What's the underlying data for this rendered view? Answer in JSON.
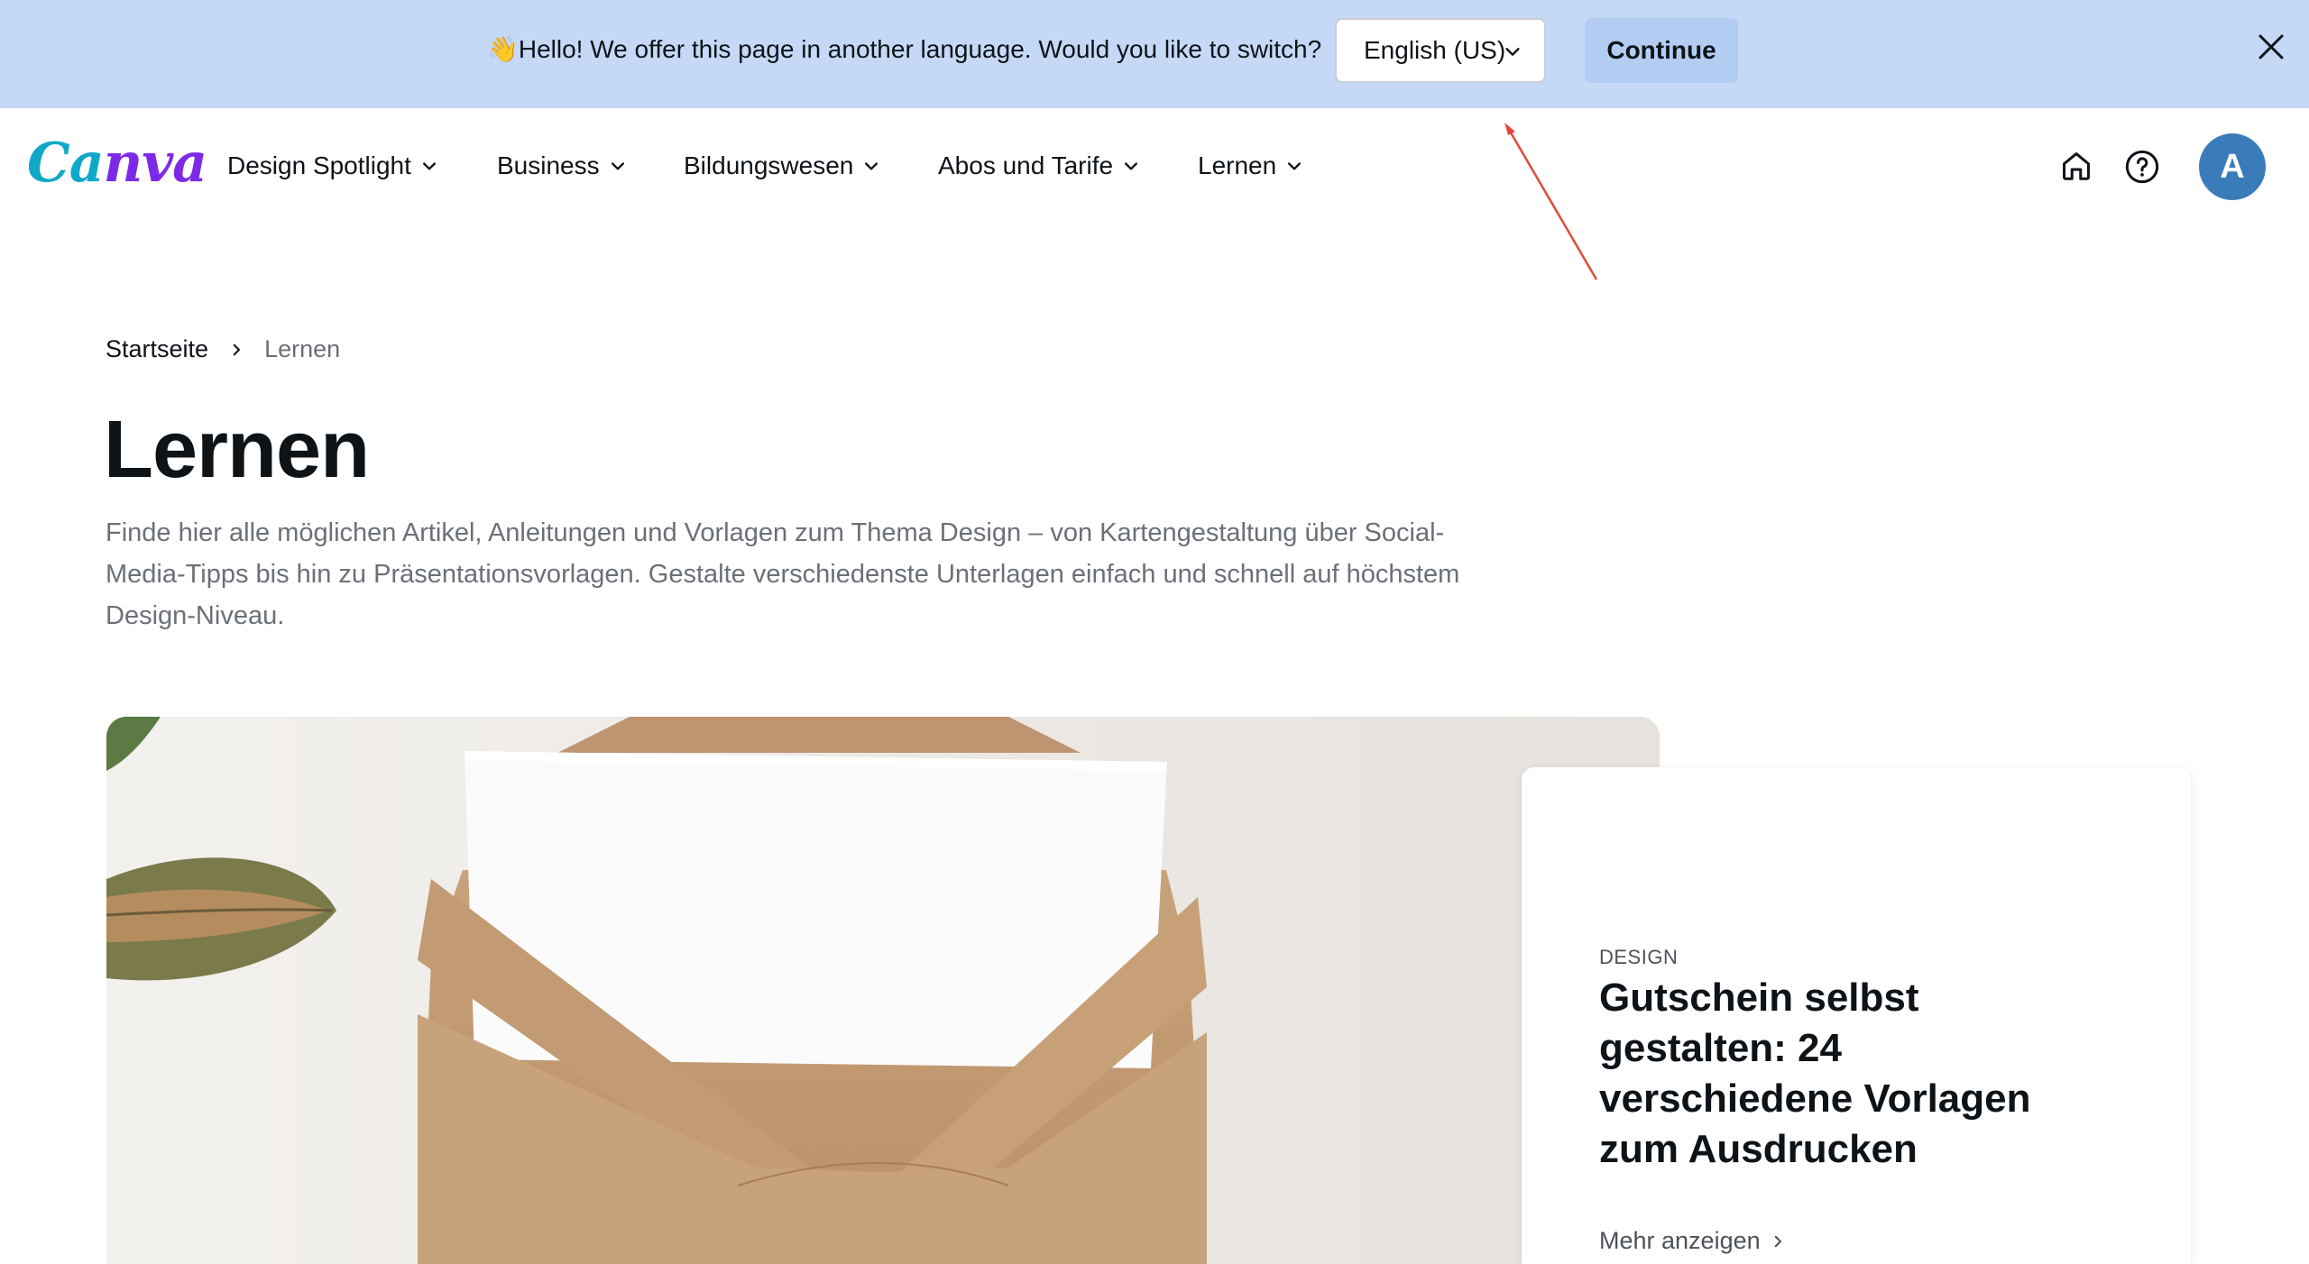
{
  "banner": {
    "emoji": "👋",
    "message": "Hello! We offer this page in another language. Would you like to switch?",
    "language_selected": "English (US)",
    "continue_label": "Continue",
    "background_color": "#c5d9f7"
  },
  "header": {
    "logo_text": "Canva",
    "nav": [
      {
        "label": "Design Spotlight"
      },
      {
        "label": "Business"
      },
      {
        "label": "Bildungswesen"
      },
      {
        "label": "Abos und Tarife"
      },
      {
        "label": "Lernen"
      }
    ],
    "icons": [
      "home-icon",
      "help-icon"
    ],
    "avatar_letter": "A",
    "avatar_color": "#3a7cba"
  },
  "breadcrumb": {
    "home": "Startseite",
    "current": "Lernen"
  },
  "page": {
    "title": "Lernen",
    "intro": "Finde hier alle möglichen Artikel, Anleitungen und Vorlagen zum Thema Design – von Kartengestaltung über Social-Media-Tipps bis hin zu Präsentationsvorlagen. Gestalte verschiedenste Unterlagen einfach und schnell auf höchstem Design-Niveau."
  },
  "featured": {
    "category": "DESIGN",
    "title": "Gutschein selbst gestalten: 24 verschiedene Vorlagen zum Ausdrucken",
    "more_label": "Mehr anzeigen"
  }
}
